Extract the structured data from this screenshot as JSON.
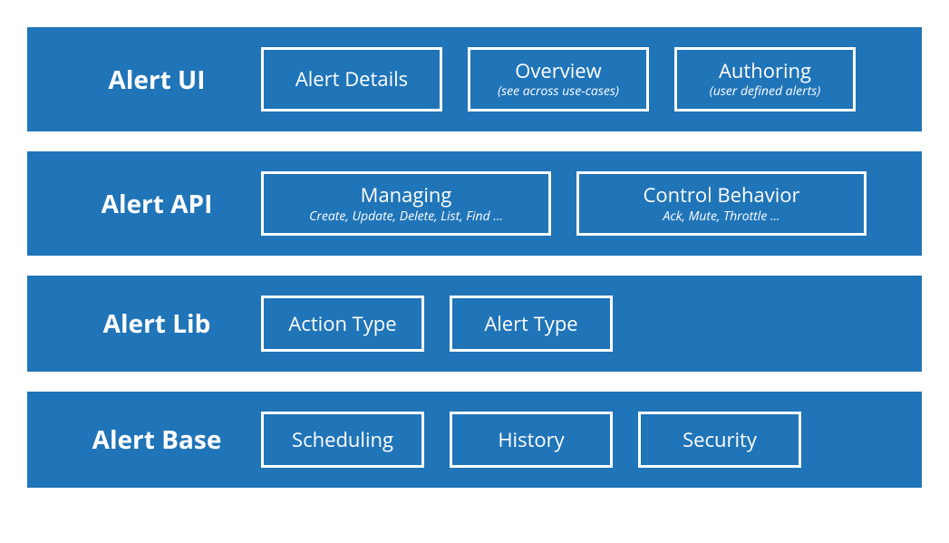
{
  "layers": [
    {
      "title": "Alert UI",
      "boxes": [
        {
          "title": "Alert Details",
          "sub": ""
        },
        {
          "title": "Overview",
          "sub": "(see across use-cases)"
        },
        {
          "title": "Authoring",
          "sub": "(user defined alerts)"
        }
      ]
    },
    {
      "title": "Alert API",
      "boxes": [
        {
          "title": "Managing",
          "sub": "Create, Update, Delete, List, Find ..."
        },
        {
          "title": "Control Behavior",
          "sub": "Ack, Mute, Throttle ..."
        }
      ]
    },
    {
      "title": "Alert Lib",
      "boxes": [
        {
          "title": "Action Type",
          "sub": ""
        },
        {
          "title": "Alert Type",
          "sub": ""
        }
      ]
    },
    {
      "title": "Alert Base",
      "boxes": [
        {
          "title": "Scheduling",
          "sub": ""
        },
        {
          "title": "History",
          "sub": ""
        },
        {
          "title": "Security",
          "sub": ""
        }
      ]
    }
  ],
  "colors": {
    "bg": "#2074b8",
    "fg": "#ffffff"
  }
}
